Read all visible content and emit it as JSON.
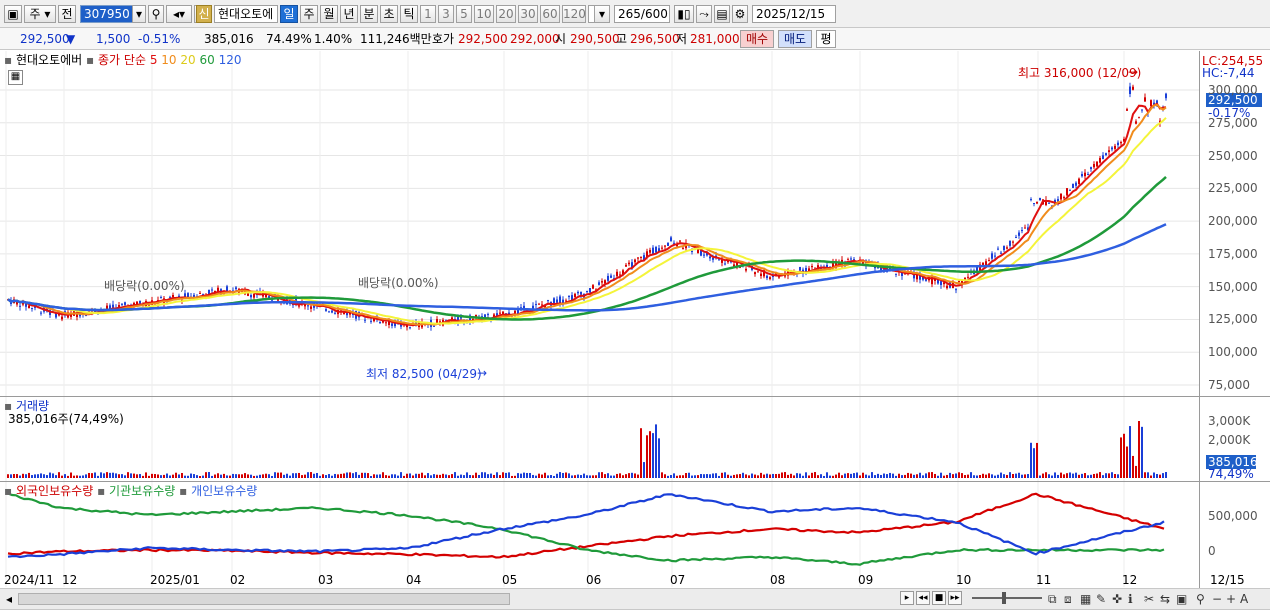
{
  "toolbar": {
    "period": "주",
    "prev_label": "전",
    "code": "307950",
    "new_badge": "신",
    "stock_name": "현대오토에",
    "intervals": [
      "일",
      "주",
      "월",
      "년",
      "분",
      "초",
      "틱"
    ],
    "minute_steps": [
      "1",
      "3",
      "5",
      "10",
      "20",
      "30",
      "60",
      "120"
    ],
    "count_value": "265",
    "count_total": "/600",
    "date": "2025/12/15"
  },
  "quote": {
    "price": "292,500",
    "change": "1,500",
    "change_pct": "-0.51%",
    "volume": "385,016",
    "vol_ratio": "74.49%",
    "turnover": "1.40%",
    "amount": "111,246백만",
    "bid_label": "호가",
    "bid": "292,500",
    "ask": "292,000",
    "open_label": "시",
    "open": "290,500",
    "high_label": "고",
    "high": "296,500",
    "low_label": "저",
    "low": "281,000",
    "buy_label": "매수",
    "sell_label": "매도",
    "eval_label": "평"
  },
  "price_pane": {
    "name": "현대오토에버",
    "legend_prefix": "종가 단순",
    "ma_labels": [
      "5",
      "10",
      "20",
      "60",
      "120"
    ],
    "lc_label": "LC:254,55",
    "hc_label": "HC:-7,44",
    "current_price_tag": "292,500",
    "current_pct_tag": "-0.17%",
    "max_label": "최고 316,000 (12/09)",
    "min_label": "최저 82,500 (04/29)",
    "dividend_label": "배당락(0.00%)",
    "y_ticks": [
      "300,000",
      "275,000",
      "250,000",
      "225,000",
      "200,000",
      "175,000",
      "150,000",
      "125,000",
      "100,000",
      "75,000"
    ]
  },
  "volume_pane": {
    "title": "거래량",
    "subtitle": "385,016주(74,49%)",
    "y_ticks": [
      "3,000K",
      "2,000K",
      "1,000K"
    ],
    "current_tag": "385,016",
    "current_pct": "74,49%"
  },
  "holding_pane": {
    "foreign_label": "외국인보유수량",
    "inst_label": "기관보유수량",
    "indiv_label": "개인보유수량",
    "y_ticks": [
      "500,000",
      "0"
    ]
  },
  "x_axis": [
    "2024/11",
    "12",
    "2025/01",
    "02",
    "03",
    "04",
    "05",
    "06",
    "07",
    "08",
    "09",
    "10",
    "11",
    "12",
    "12/15"
  ],
  "colors": {
    "up": "#d40000",
    "down": "#1a3fd8",
    "ma5": "#e01010",
    "ma10": "#f08c1c",
    "ma20": "#f4f43a",
    "ma60": "#1f9a3a",
    "ma120": "#2f5fe0"
  },
  "chart_data": {
    "type": "line",
    "series": [
      {
        "name": "종가",
        "x": [
          "2024/11",
          "2024/12",
          "2025/01",
          "2025/02",
          "2025/03",
          "2025/04",
          "2025/05",
          "2025/06",
          "2025/07",
          "2025/08",
          "2025/09",
          "2025/10",
          "2025/11",
          "2025/12"
        ],
        "values": [
          140000,
          128000,
          138000,
          148000,
          135000,
          120000,
          128000,
          145000,
          185000,
          158000,
          170000,
          150000,
          200000,
          292500
        ]
      },
      {
        "name": "외국인보유수량",
        "values": [
          -50000,
          -20000,
          0,
          -10000,
          -40000,
          -60000,
          -100000,
          50000,
          200000,
          300000,
          250000,
          400000,
          800000,
          300000
        ]
      },
      {
        "name": "기관보유수량",
        "values": [
          800000,
          600000,
          500000,
          550000,
          600000,
          500000,
          300000,
          0,
          -150000,
          -100000,
          -200000,
          0,
          0,
          0
        ]
      },
      {
        "name": "개인보유수량",
        "values": [
          -100000,
          -60000,
          30000,
          0,
          -20000,
          20000,
          300000,
          500000,
          800000,
          550000,
          600000,
          400000,
          -50000,
          400000
        ]
      }
    ],
    "ylim": [
      75000,
      320000
    ]
  }
}
